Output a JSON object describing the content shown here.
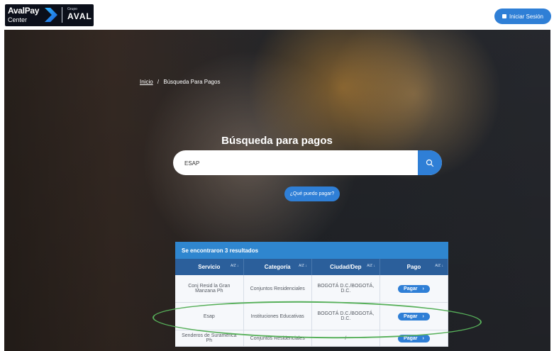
{
  "brand": {
    "name": "AvalPay",
    "sub": "Center",
    "group_small": "Grupo",
    "group": "AVAL"
  },
  "header": {
    "login_label": "Iniciar Sesión"
  },
  "breadcrumb": {
    "home": "Inicio",
    "separator": "/",
    "current": "Búsqueda Para Pagos"
  },
  "search": {
    "title": "Búsqueda para pagos",
    "value": "ESAP",
    "help_label": "¿Qué puedo pagar?"
  },
  "results": {
    "summary": "Se encontraron 3 resultados",
    "columns": [
      {
        "label": "Servicio",
        "sort": "A/Z ↓"
      },
      {
        "label": "Categoría",
        "sort": "A/Z ↓"
      },
      {
        "label": "Ciudad/Dep",
        "sort": "A/Z ↓"
      },
      {
        "label": "Pago",
        "sort": "A/Z ↓"
      }
    ],
    "rows": [
      {
        "servicio": "Conj Resid la Gran Manzana Ph",
        "categoria": "Conjuntos Residenciales",
        "ciudad": "BOGOTÁ D.C./BOGOTÁ, D.C.",
        "pago": "Pagar"
      },
      {
        "servicio": "Esap",
        "categoria": "Instituciones Educativas",
        "ciudad": "BOGOTÁ D.C./BOGOTÁ, D.C.",
        "pago": "Pagar"
      },
      {
        "servicio": "Senderos de Suramerica Ph",
        "categoria": "Conjuntos Residenciales",
        "ciudad": "/",
        "pago": "Pagar"
      }
    ]
  },
  "colors": {
    "accent": "#2f7fd6",
    "table_header": "#2b5f9b",
    "highlight": "#57b05a"
  },
  "icons": {
    "search": "search-icon",
    "lock": "lock-icon",
    "chevron": "chevron-right-icon"
  }
}
